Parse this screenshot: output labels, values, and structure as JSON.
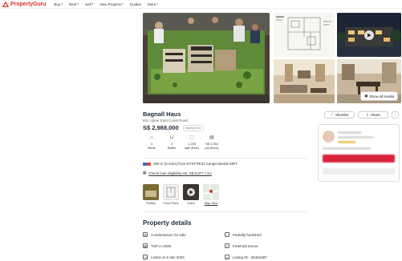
{
  "brand": {
    "name": "PropertyGuru",
    "color": "#d9352c"
  },
  "nav": [
    {
      "label": "Buy"
    },
    {
      "label": "Rent"
    },
    {
      "label": "Sell"
    },
    {
      "label": "New Projects"
    },
    {
      "label": "Guides"
    },
    {
      "label": "More"
    }
  ],
  "gallery": {
    "show_all_label": "Show all media"
  },
  "listing": {
    "title": "Bagnall Haus",
    "address": "911 Upper East Coast Road",
    "price": "S$ 2,988,000",
    "price_tag": "Starting from",
    "actions": {
      "shortlist": "Shortlist",
      "share": "Share"
    },
    "specs": [
      {
        "icon": "bed-icon",
        "value": "4",
        "unit": "Beds"
      },
      {
        "icon": "bath-icon",
        "value": "3",
        "unit": "Baths"
      },
      {
        "icon": "area-icon",
        "value": "1,249",
        "unit": "sqft (floor)"
      },
      {
        "icon": "psf-icon",
        "value": "S$ 2,392",
        "unit": "psf (floor)"
      }
    ],
    "mrt": "380 m (5 mins) from DT37/TE31 Sungei Bedok MRT",
    "loan": "Check loan eligibility est. S$ 8,977 / mo"
  },
  "media": [
    {
      "label": "Photos"
    },
    {
      "label": "Floor Plans"
    },
    {
      "label": "Video"
    },
    {
      "label": "Map View"
    }
  ],
  "details": {
    "title": "Property details",
    "items": [
      {
        "icon": "building-icon",
        "label": "Condominium for sale"
      },
      {
        "icon": "sofa-icon",
        "label": "Partially furnished"
      },
      {
        "icon": "calendar-icon",
        "label": "TOP in 2028"
      },
      {
        "icon": "document-icon",
        "label": "Freehold tenure"
      },
      {
        "icon": "clock-icon",
        "label": "Listed on 8 Jan 2026"
      },
      {
        "icon": "id-icon",
        "label": "Listing ID - 25451597"
      }
    ]
  }
}
